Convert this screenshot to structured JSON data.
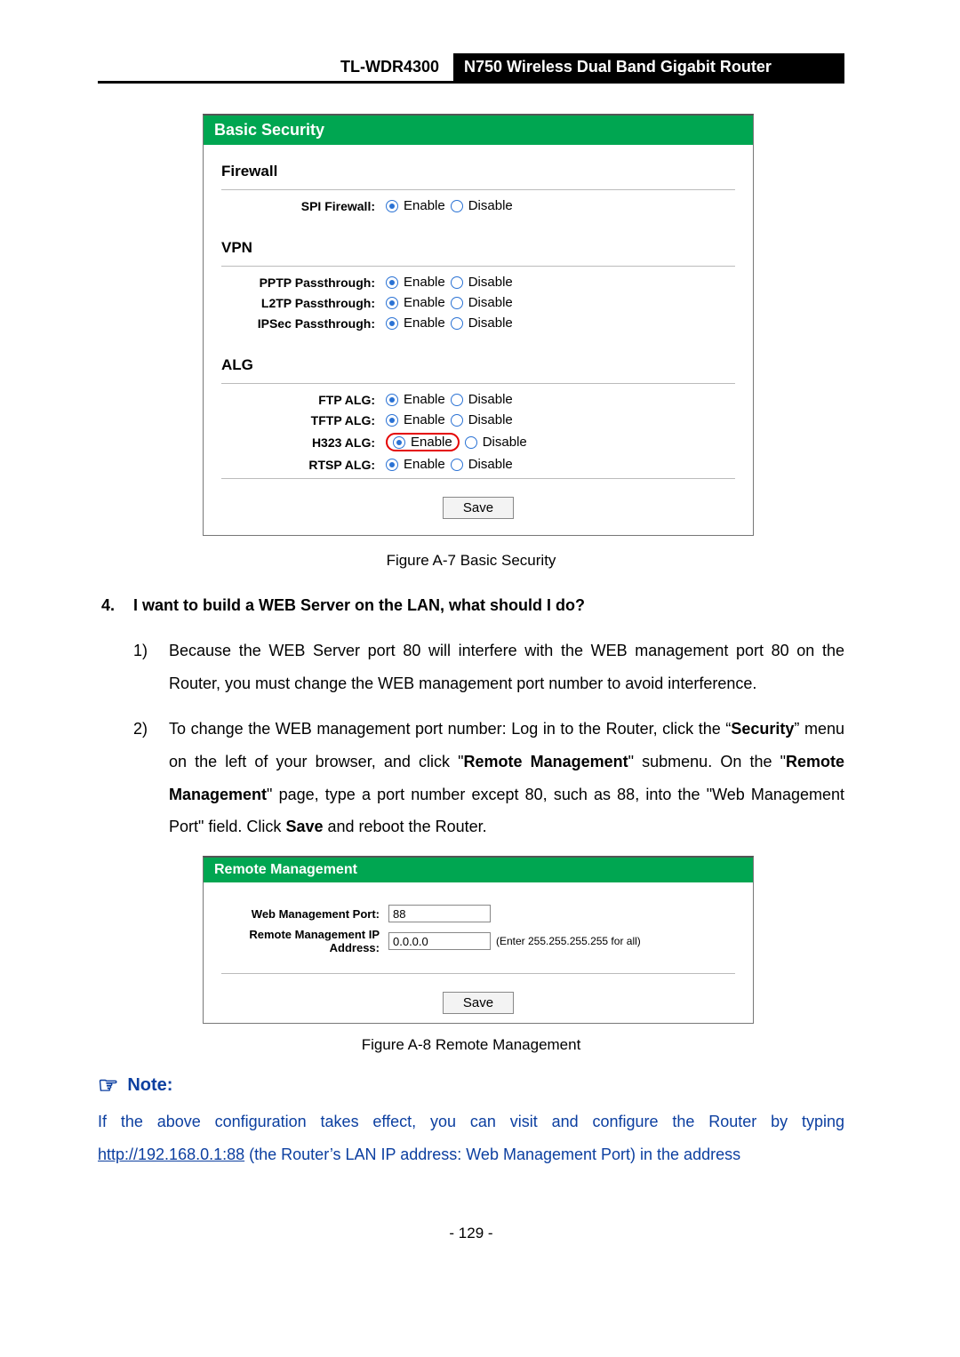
{
  "header": {
    "model": "TL-WDR4300",
    "product": "N750 Wireless Dual Band Gigabit Router"
  },
  "basic_security": {
    "title": "Basic Security",
    "sections": {
      "firewall": {
        "heading": "Firewall",
        "rows": [
          {
            "label": "SPI Firewall:",
            "enable": "Enable",
            "disable": "Disable",
            "selected": "enable"
          }
        ]
      },
      "vpn": {
        "heading": "VPN",
        "rows": [
          {
            "label": "PPTP Passthrough:",
            "enable": "Enable",
            "disable": "Disable",
            "selected": "enable"
          },
          {
            "label": "L2TP Passthrough:",
            "enable": "Enable",
            "disable": "Disable",
            "selected": "enable"
          },
          {
            "label": "IPSec Passthrough:",
            "enable": "Enable",
            "disable": "Disable",
            "selected": "enable"
          }
        ]
      },
      "alg": {
        "heading": "ALG",
        "rows": [
          {
            "label": "FTP ALG:",
            "enable": "Enable",
            "disable": "Disable",
            "selected": "enable"
          },
          {
            "label": "TFTP ALG:",
            "enable": "Enable",
            "disable": "Disable",
            "selected": "enable"
          },
          {
            "label": "H323 ALG:",
            "enable": "Enable",
            "disable": "Disable",
            "selected": "enable",
            "highlight": true
          },
          {
            "label": "RTSP ALG:",
            "enable": "Enable",
            "disable": "Disable",
            "selected": "enable"
          }
        ]
      }
    },
    "save_label": "Save",
    "caption": "Figure A-7 Basic Security"
  },
  "question": {
    "number": "4.",
    "text": "I want to build a WEB Server on the LAN, what should I do?"
  },
  "steps": {
    "s1": {
      "num": "1)",
      "text": "Because the WEB Server port 80 will interfere with the WEB management port 80 on the Router, you must change the WEB management port number to avoid interference."
    },
    "s2": {
      "num": "2)",
      "pre": "To change the WEB management port number: Log in to the Router, click the “",
      "b1": "Security",
      "mid1": "” menu on the left of your browser, and click \"",
      "b2": "Remote Management",
      "mid2": "\" submenu. On the \"",
      "b3": "Remote Management",
      "mid3": "\" page, type a port number except 80, such as 88, into the \"Web Management Port\" field. Click ",
      "b4": "Save",
      "post": " and reboot the Router."
    }
  },
  "remote_mgmt": {
    "title": "Remote Management",
    "port_label": "Web Management Port:",
    "port_value": "88",
    "ip_label": "Remote Management IP Address:",
    "ip_value": "0.0.0.0",
    "ip_hint": "(Enter 255.255.255.255 for all)",
    "save_label": "Save",
    "caption": "Figure A-8 Remote Management"
  },
  "note": {
    "heading": "Note:",
    "pre": "If the above configuration takes effect, you can visit and configure the Router by typing ",
    "link": "http://192.168.0.1:88",
    "post": " (the Router’s LAN IP address: Web Management Port) in the address"
  },
  "page_number": "- 129 -"
}
